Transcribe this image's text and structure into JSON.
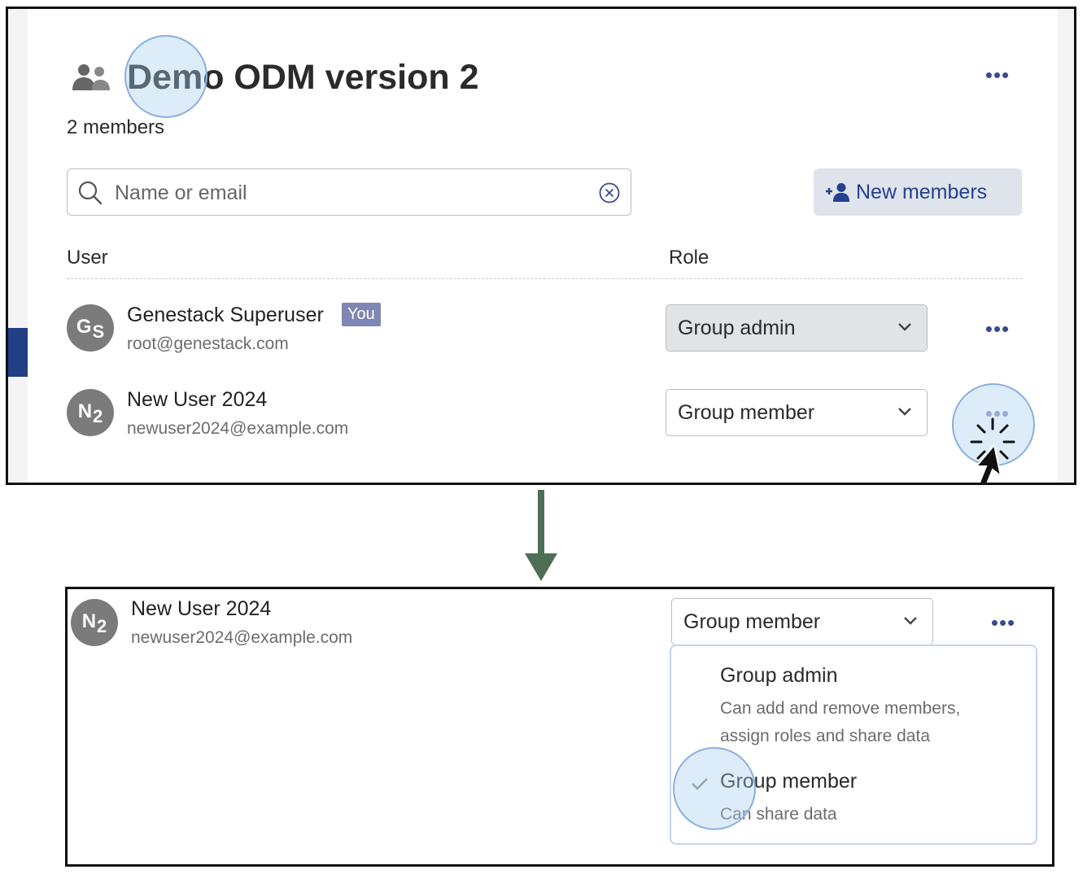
{
  "group": {
    "title": "Demo ODM version 2",
    "members_count": "2 members",
    "menu_glyph": "•••"
  },
  "search": {
    "placeholder": "Name or email",
    "value": ""
  },
  "new_members_button": {
    "label": "New members"
  },
  "table": {
    "col_user": "User",
    "col_role": "Role"
  },
  "users": [
    {
      "initials": "G",
      "initials_sub": "S",
      "name": "Genestack Superuser",
      "badge": "You",
      "email": "root@genestack.com",
      "role": "Group admin"
    },
    {
      "initials": "N",
      "initials_sub": "2",
      "name": "New User 2024",
      "email": "newuser2024@example.com",
      "role": "Group member"
    }
  ],
  "detail": {
    "initials": "N",
    "initials_sub": "2",
    "name": "New User 2024",
    "email": "newuser2024@example.com",
    "role": "Group member",
    "role_options": [
      {
        "label": "Group admin",
        "description": "Can add and remove members, assign roles and share data",
        "selected": false
      },
      {
        "label": "Group member",
        "description": "Can share data",
        "selected": true
      }
    ]
  },
  "colors": {
    "accent": "#24408f",
    "badge": "#7e86b5",
    "avatar": "#7b7b7b",
    "arrow": "#4e6e56",
    "highlight": "#a6cdf0"
  },
  "icons": {
    "group": "group-icon",
    "search": "search-icon",
    "clear": "clear-circle-x-icon",
    "add_user": "add-user-icon",
    "chevron": "chevron-down-icon",
    "more": "more-horizontal-icon",
    "check": "check-icon",
    "cursor": "pointer-cursor-icon"
  }
}
